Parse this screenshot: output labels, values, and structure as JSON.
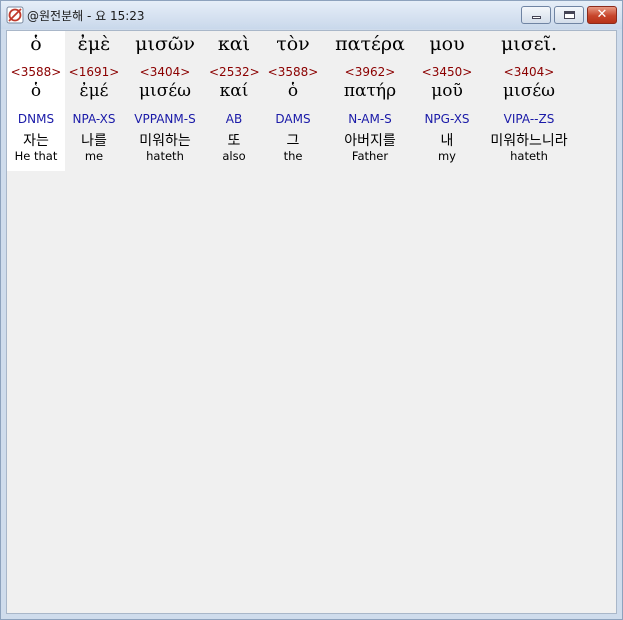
{
  "window": {
    "title": "@원전분해 - 요 15:23"
  },
  "words": [
    {
      "greek": "ὁ",
      "strong": "<3588>",
      "lemma": "ὁ",
      "parse": "DNMS",
      "korean": "자는",
      "english": "He that"
    },
    {
      "greek": "ἐμὲ",
      "strong": "<1691>",
      "lemma": "ἐμέ",
      "parse": "NPA-XS",
      "korean": "나를",
      "english": "me"
    },
    {
      "greek": "μισῶν",
      "strong": "<3404>",
      "lemma": "μισέω",
      "parse": "VPPANM-S",
      "korean": "미워하는",
      "english": "hateth"
    },
    {
      "greek": "καὶ",
      "strong": "<2532>",
      "lemma": "καί",
      "parse": "AB",
      "korean": "또",
      "english": "also"
    },
    {
      "greek": "τὸν",
      "strong": "<3588>",
      "lemma": "ὁ",
      "parse": "DAMS",
      "korean": "그",
      "english": "the"
    },
    {
      "greek": "πατέρα",
      "strong": "<3962>",
      "lemma": "πατήρ",
      "parse": "N-AM-S",
      "korean": "아버지를",
      "english": "Father"
    },
    {
      "greek": "μου",
      "strong": "<3450>",
      "lemma": "μοῦ",
      "parse": "NPG-XS",
      "korean": "내",
      "english": "my"
    },
    {
      "greek": "μισεῖ.",
      "strong": "<3404>",
      "lemma": "μισέω",
      "parse": "VIPA--ZS",
      "korean": "미워하느니라",
      "english": "hateth"
    }
  ],
  "colors": {
    "strong": "#8b0000",
    "parse": "#1a1aa8",
    "selected_bg": "#ffffff",
    "close_button": "#c7452b"
  }
}
